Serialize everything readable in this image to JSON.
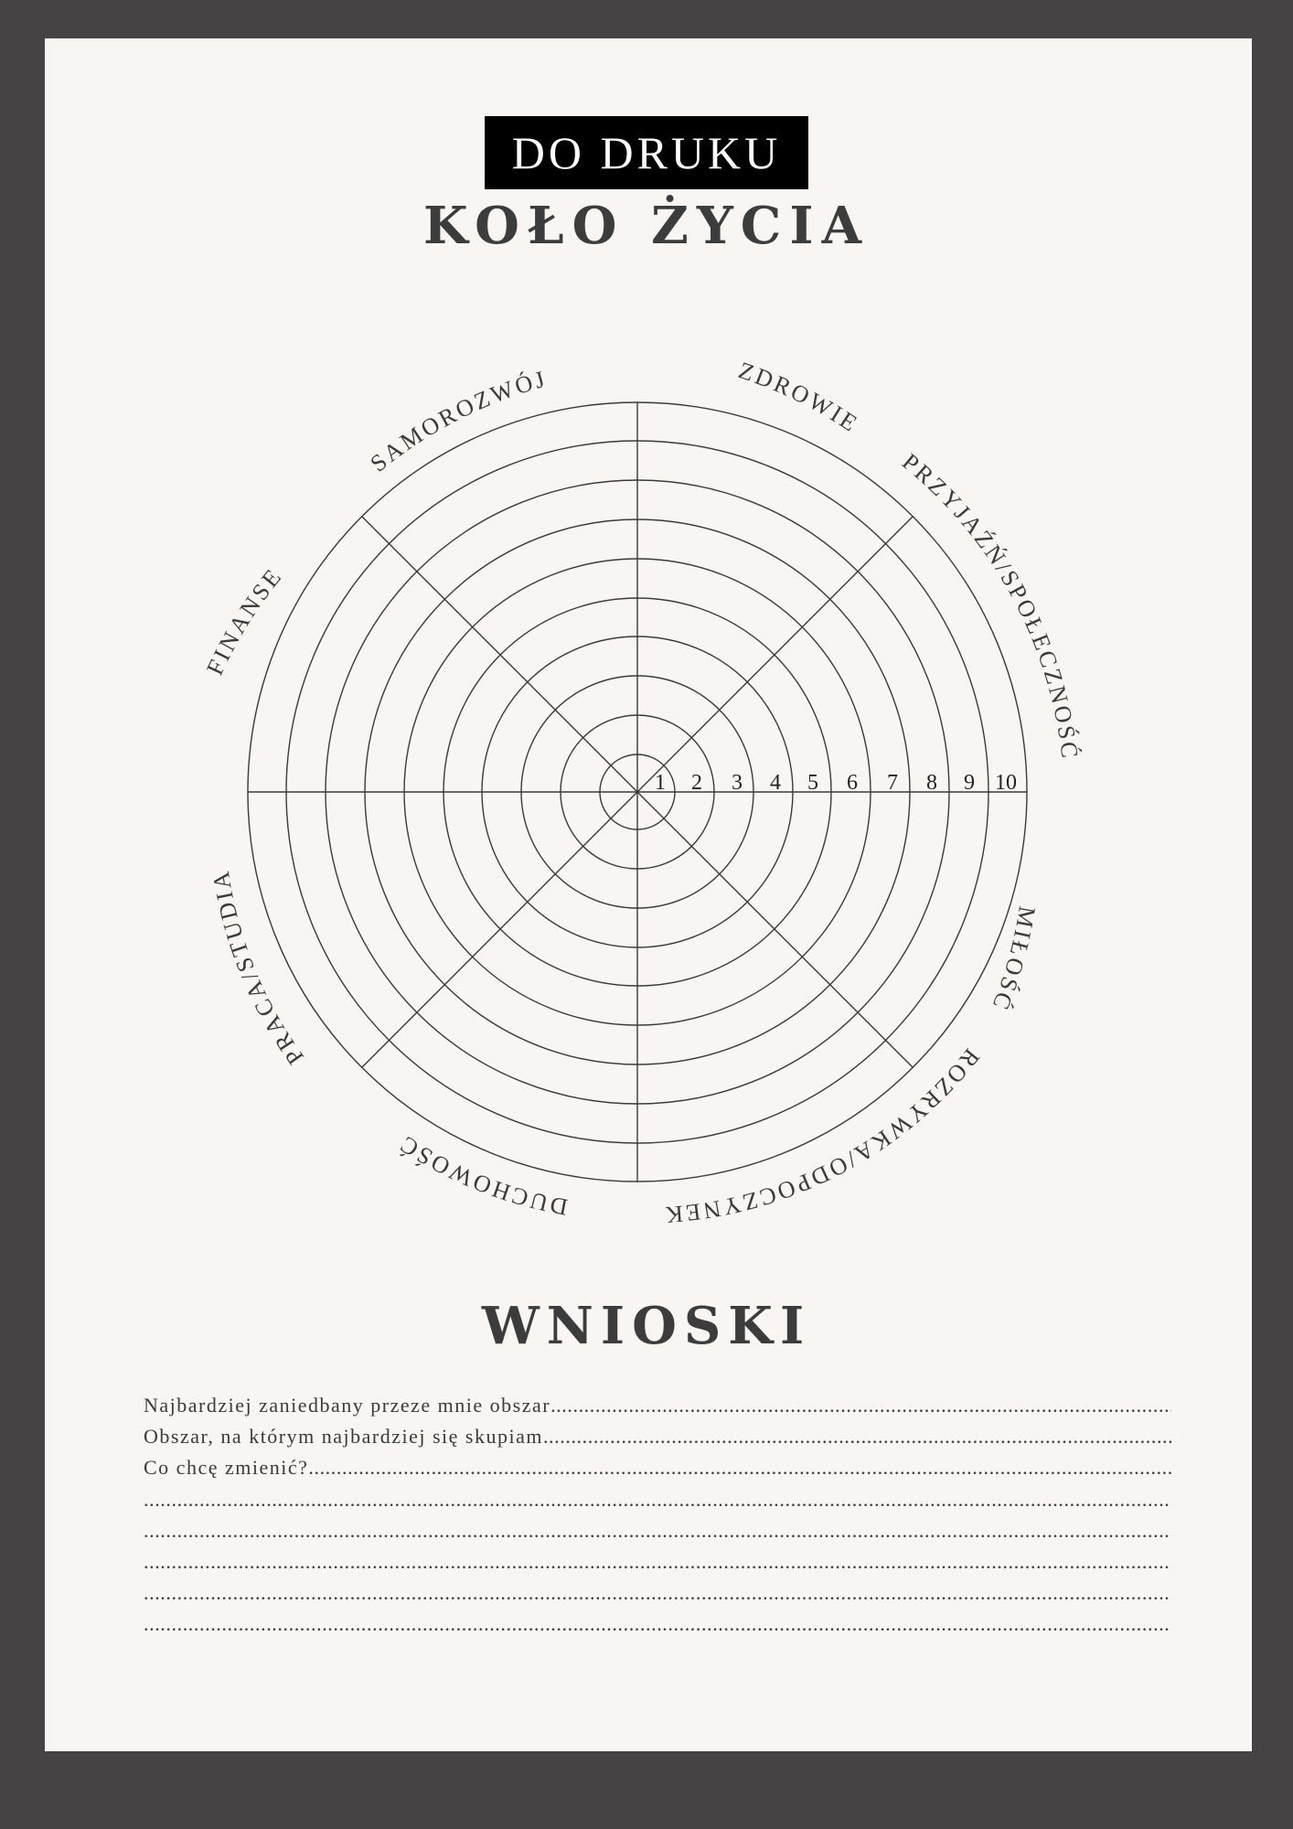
{
  "badge": "DO DRUKU",
  "title": "KOŁO ŻYCIA",
  "wheel": {
    "scale_numbers": [
      "1",
      "2",
      "3",
      "4",
      "5",
      "6",
      "7",
      "8",
      "9",
      "10"
    ],
    "areas": [
      "ZDROWIE",
      "PRZYJAŹŃ/SPOŁECZNOŚĆ",
      "MIŁOŚĆ",
      "ROZRYWKA/ODPOCZYNEK",
      "DUCHOWOŚĆ",
      "PRACA/STUDIA",
      "FINANSE",
      "SAMOROZWÓJ"
    ]
  },
  "conclusions": {
    "title": "WNIOSKI",
    "lines": [
      "Najbardziej zaniedbany przeze mnie obszar",
      "Obszar, na którym najbardziej się skupiam",
      "Co chcę zmienić?",
      "",
      "",
      "",
      "",
      ""
    ]
  }
}
